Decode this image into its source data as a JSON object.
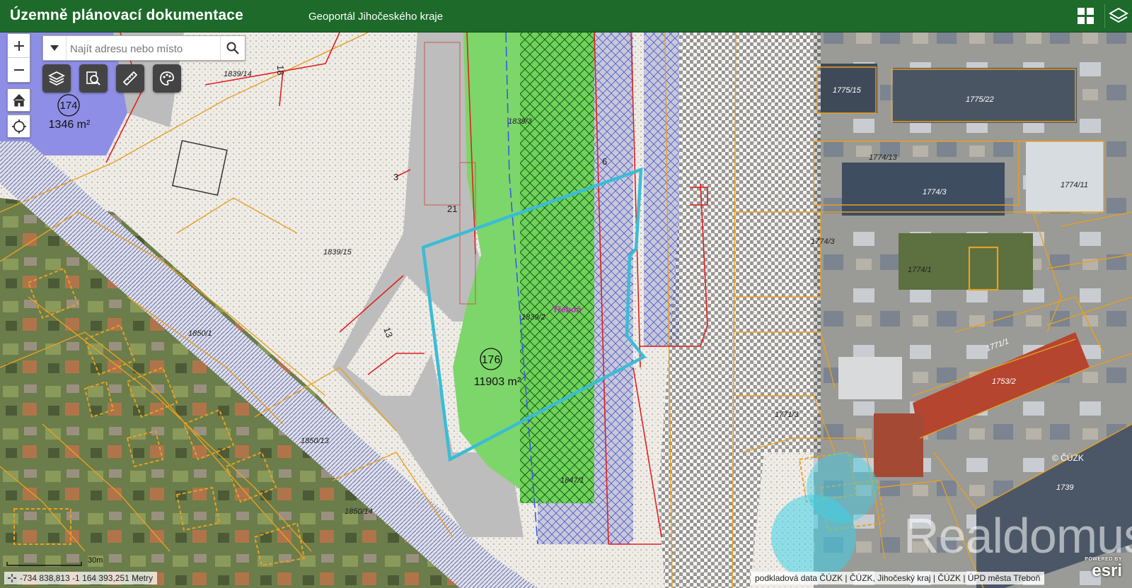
{
  "header": {
    "title": "Územně plánovací dokumentace",
    "subtitle": "Geoportál Jihočeského kraje"
  },
  "search": {
    "placeholder": "Najít adresu nebo místo"
  },
  "map": {
    "parcels": {
      "p1839_14": "1839/14",
      "p18": "18",
      "p1839_3": "1839/3",
      "p6": "6",
      "p3": "3",
      "p21": "21",
      "p1839_15": "1839/15",
      "p13": "13",
      "p1839_2": "1839/2",
      "p1847_1": "1847/1",
      "p1850_1": "1850/1",
      "p1850_13": "1850/13",
      "p1850_14": "1850/14",
      "p1774_13": "1774/13",
      "p1774_3a": "1774/3",
      "p1774_3b": "1774/3",
      "p1774_11": "1774/11",
      "p1774_1": "1774/1",
      "p1771_1": "1771/1",
      "p1771_3": "1771/3",
      "p1753_2": "1753/2",
      "p1739": "1739",
      "p1775_22": "1775/22",
      "p1775_15": "1775/15"
    },
    "zone174": {
      "number": "174",
      "area": "1346 m²"
    },
    "zone176": {
      "number": "176",
      "area": "11903 m²"
    },
    "place": "Třeboň",
    "cuzk": "© ČÚZK",
    "scale": "30m",
    "watermark": "Realdomus"
  },
  "coordinates": "-734 838,813 -1 164 393,251 Metry",
  "attribution": "podkladová data ČÚZK | ČÚZK, Jihočeský kraj | ČÚZK | ÚPD města Třeboň",
  "esri": {
    "powered_by": "POWERED BY",
    "logo": "esri"
  },
  "colors": {
    "header": "#1d6a2a",
    "highlight": "#3bbcd6",
    "green_area": "#7dd66a",
    "parcel_line": "#e8a020",
    "red_line": "#e02020",
    "road": "#b9b9b9"
  }
}
